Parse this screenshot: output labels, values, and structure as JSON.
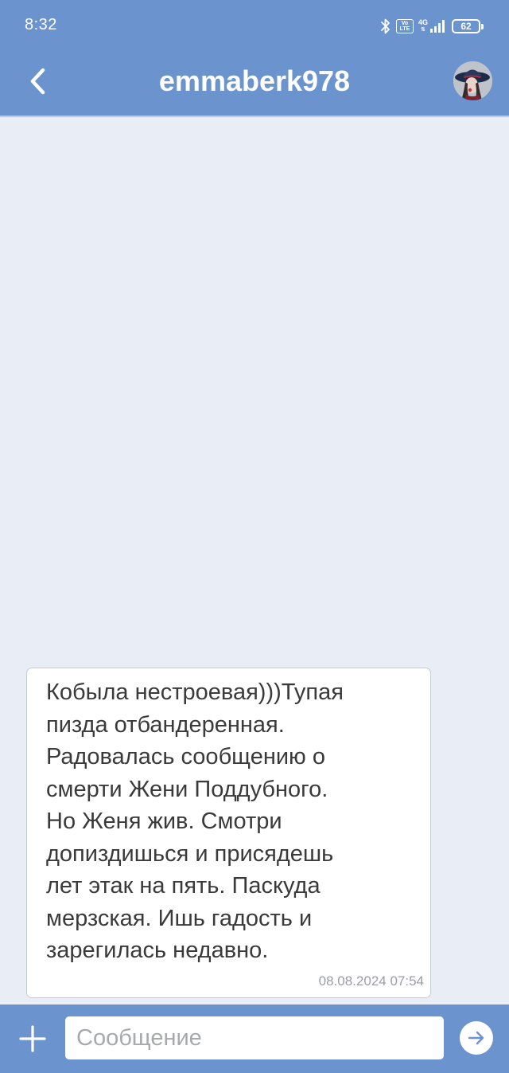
{
  "status_bar": {
    "time": "8:32",
    "volte_label": "Vo LTE",
    "network_label": "4G",
    "battery_level": "62"
  },
  "header": {
    "title": "emmaberk978",
    "back_icon": "chevron-left-icon",
    "avatar": "user-avatar"
  },
  "messages": [
    {
      "text": "Кобыла нестроевая)))Тупая\nпизда отбандеренная.\nРадовалась сообщению о\nсмерти Жени Поддубного.\nНо Женя жив. Смотри\nдопиздишься и присядешь\nлет этак на пять. Паскуда\nмерзская. Ишь гадость и\nзарегилась недавно.",
      "timestamp": "08.08.2024 07:54"
    }
  ],
  "composer": {
    "placeholder": "Сообщение",
    "value": "",
    "attach_icon": "plus-icon",
    "send_icon": "arrow-right-icon"
  },
  "colors": {
    "accent": "#6b93cd",
    "chat_background": "#e9edf6",
    "bubble": "#ffffff",
    "text": "#3a3a3a",
    "timestamp": "#9a9da3"
  }
}
